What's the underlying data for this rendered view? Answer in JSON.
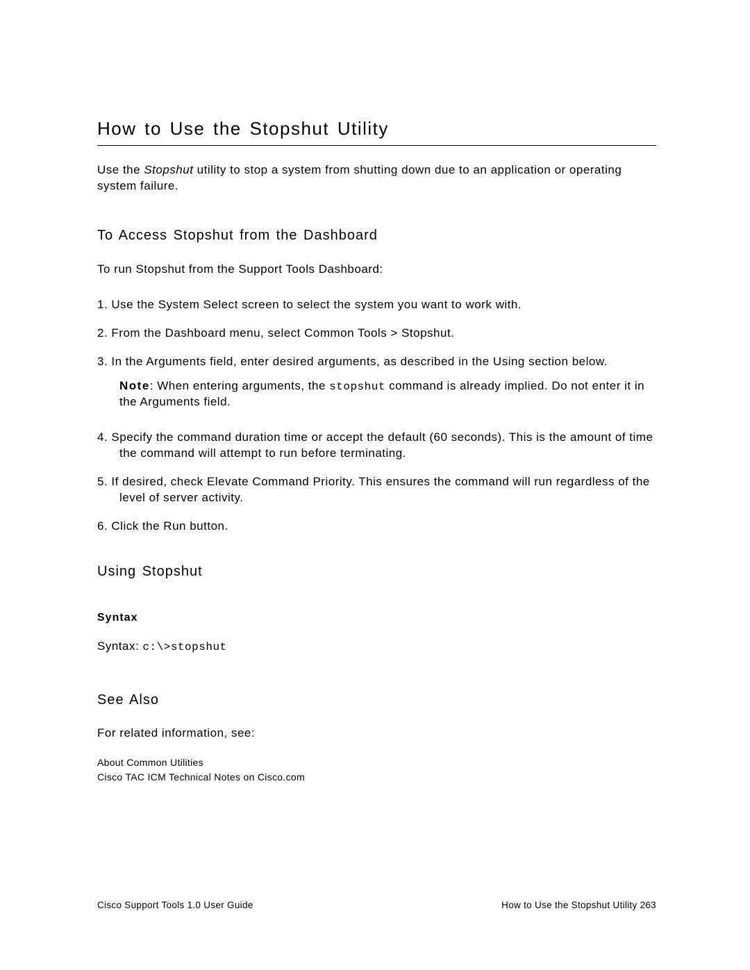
{
  "heading": "How to Use the Stopshut Utility",
  "intro": {
    "pre": "Use the ",
    "italic": "Stopshut",
    "post": " utility to stop a system from shutting down due to an application or operating system failure."
  },
  "section1": {
    "heading": "To Access Stopshut from the Dashboard",
    "text": "To run Stopshut from the Support Tools Dashboard:",
    "items": {
      "i1": "1.  Use the System Select screen to select the system you want to work with.",
      "i2": "2.  From the Dashboard menu, select Common Tools > Stopshut.",
      "i3": "3.  In the Arguments field, enter desired arguments, as described in the Using section below.",
      "note_label": "Note",
      "note_pre": ": When entering arguments, the ",
      "note_mono": "stopshut",
      "note_post": " command is already implied. Do not enter it in the Arguments field.",
      "i4": "4.  Specify the command duration time or accept the default (60 seconds). This is the amount of time the command will attempt to run before terminating.",
      "i5": "5.  If desired, check Elevate Command Priority. This ensures the command will run regardless of the level of server activity.",
      "i6": "6.  Click the Run button."
    }
  },
  "section2": {
    "heading": "Using Stopshut",
    "subheading": "Syntax",
    "syntax_label": "Syntax: ",
    "syntax_code": "c:\\>stopshut"
  },
  "section3": {
    "heading": "See Also",
    "text": "For related information, see:",
    "link1": "About Common Utilities",
    "link2": "Cisco TAC ICM Technical Notes on Cisco.com"
  },
  "footer": {
    "left": "Cisco Support Tools 1.0 User Guide",
    "right": "How to Use the Stopshut Utility   263"
  }
}
